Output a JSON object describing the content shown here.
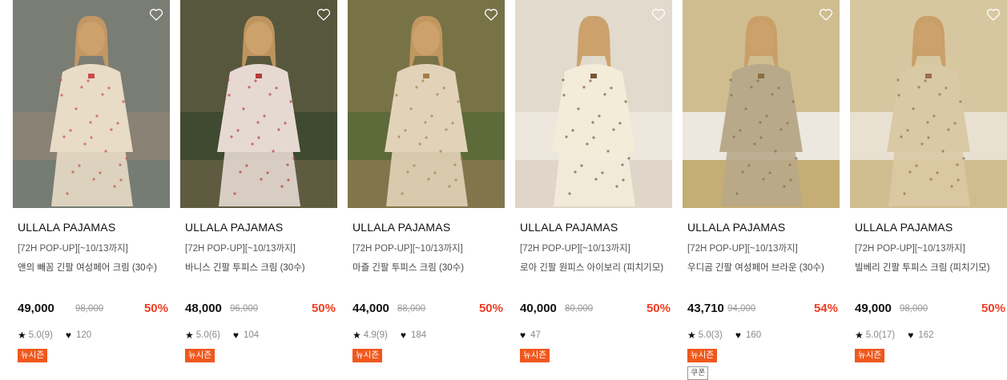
{
  "products": [
    {
      "brand": "ULLALA PAJAMAS",
      "promo": "[72H POP-UP][~10/13까지]",
      "name": "앤의 빼꼼 긴팔 여성페어 크림 (30수)",
      "price": "49,000",
      "original_price": "98,000",
      "discount": "50%",
      "rating": "5.0(9)",
      "likes": "120",
      "tags": [
        "뉴시즌"
      ],
      "image_colors": {
        "bg": "#8b8276",
        "wall": "#6e7a73",
        "fg": "#e8dcc6",
        "accent": "#c94b4b"
      }
    },
    {
      "brand": "ULLALA PAJAMAS",
      "promo": "[72H POP-UP][~10/13까지]",
      "name": "바니스 긴팔 투피스 크림 (30수)",
      "price": "48,000",
      "original_price": "96,000",
      "discount": "50%",
      "rating": "5.0(6)",
      "likes": "104",
      "tags": [
        "뉴시즌"
      ],
      "image_colors": {
        "bg": "#3f4a30",
        "wall": "#6a6247",
        "fg": "#e6d9d2",
        "accent": "#b83a3a"
      }
    },
    {
      "brand": "ULLALA PAJAMAS",
      "promo": "[72H POP-UP][~10/13까지]",
      "name": "마즐 긴팔 투피스 크림 (30수)",
      "price": "44,000",
      "original_price": "88,000",
      "discount": "50%",
      "rating": "4.9(9)",
      "likes": "184",
      "tags": [
        "뉴시즌"
      ],
      "image_colors": {
        "bg": "#5d6a3a",
        "wall": "#8d7a52",
        "fg": "#e2d3b8",
        "accent": "#a67d4a"
      }
    },
    {
      "brand": "ULLALA PAJAMAS",
      "promo": "[72H POP-UP][~10/13까지]",
      "name": "로아 긴팔 원피스 아이보리 (피치기모)",
      "price": "40,000",
      "original_price": "80,000",
      "discount": "50%",
      "rating": "",
      "likes": "47",
      "tags": [
        "뉴시즌"
      ],
      "image_colors": {
        "bg": "#ede7dd",
        "wall": "#d9cfc0",
        "fg": "#f3ecd9",
        "accent": "#7a5535"
      }
    },
    {
      "brand": "ULLALA PAJAMAS",
      "promo": "[72H POP-UP][~10/13까지]",
      "name": "우디곰 긴팔 여성페어 브라운 (30수)",
      "price": "43,710",
      "original_price": "94,000",
      "discount": "54%",
      "rating": "5.0(3)",
      "likes": "160",
      "tags": [
        "뉴시즌",
        "쿠폰"
      ],
      "image_colors": {
        "bg": "#ece7df",
        "wall": "#b89a4f",
        "fg": "#b8a98a",
        "accent": "#8a6e3e"
      }
    },
    {
      "brand": "ULLALA PAJAMAS",
      "promo": "[72H POP-UP][~10/13까지]",
      "name": "빌베리 긴팔 투피스 크림 (피치기모)",
      "price": "49,000",
      "original_price": "98,000",
      "discount": "50%",
      "rating": "5.0(17)",
      "likes": "162",
      "tags": [
        "뉴시즌"
      ],
      "image_colors": {
        "bg": "#e8e0d0",
        "wall": "#c8b27a",
        "fg": "#d9c9a4",
        "accent": "#9a6b4e"
      }
    }
  ],
  "icons": {
    "wishlist": "heart-outline-icon",
    "star": "star-icon",
    "like": "heart-filled-icon"
  },
  "colors": {
    "discount": "#ef3d23",
    "new_season_tag": "#f0581d"
  }
}
